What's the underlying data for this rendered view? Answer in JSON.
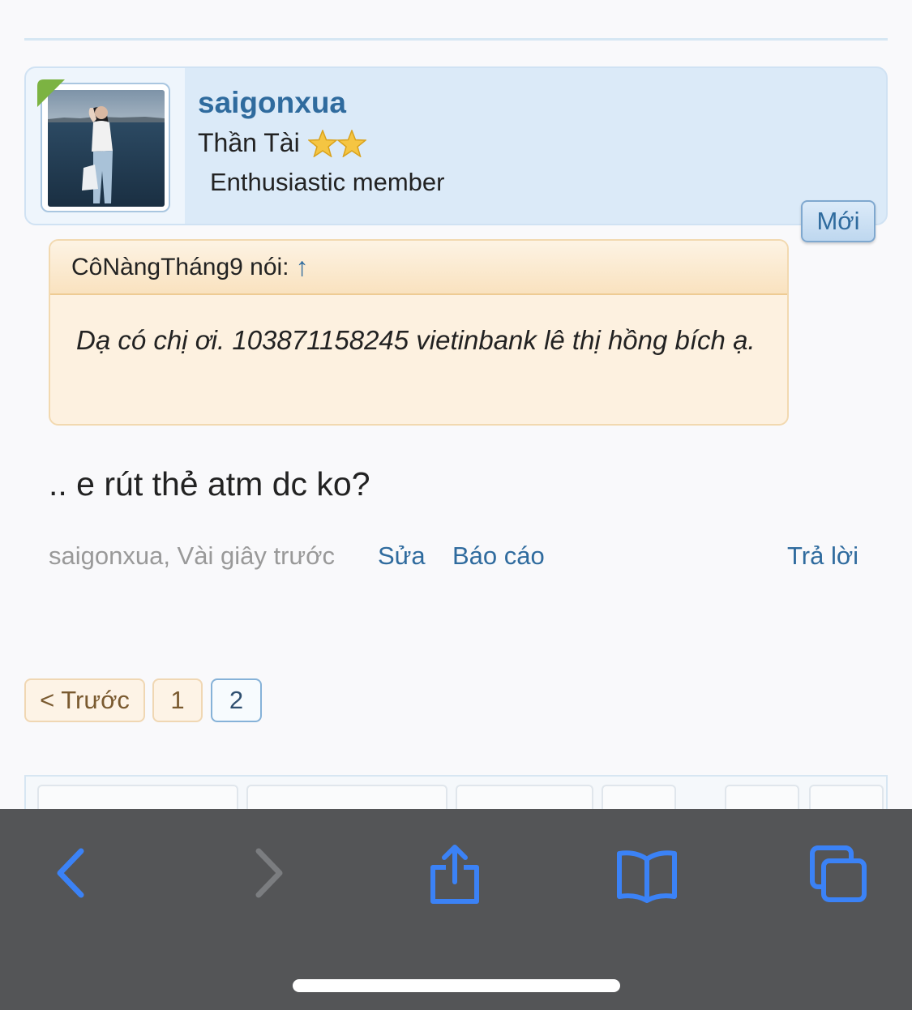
{
  "post": {
    "username": "saigonxua",
    "user_title": "Thần Tài",
    "user_rank": "Enthusiastic member",
    "new_badge": "Mới",
    "quote": {
      "author_line": "CôNàngTháng9 nói:",
      "arrow": "↑",
      "text": "Dạ có chị ơi. 103871158245 vietinbank lê thị hồng bích ạ."
    },
    "message": ".. e rút thẻ atm dc ko?",
    "meta": "saigonxua, Vài giây trước",
    "actions": {
      "edit": "Sửa",
      "report": "Báo cáo",
      "reply": "Trả lời"
    }
  },
  "pagination": {
    "prev": "< Trước",
    "pages": [
      "1",
      "2"
    ],
    "current_page": "2"
  },
  "browser_toolbar": {
    "icons": [
      "back-icon",
      "forward-icon",
      "share-icon",
      "bookmarks-icon",
      "tabs-icon"
    ]
  },
  "colors": {
    "accent": "#2f6b9e",
    "card_bg": "#dbeaf8",
    "quote_bg": "#fdf1e0",
    "toolbar_bg": "#545557",
    "toolbar_icon": "#3b82f6"
  }
}
